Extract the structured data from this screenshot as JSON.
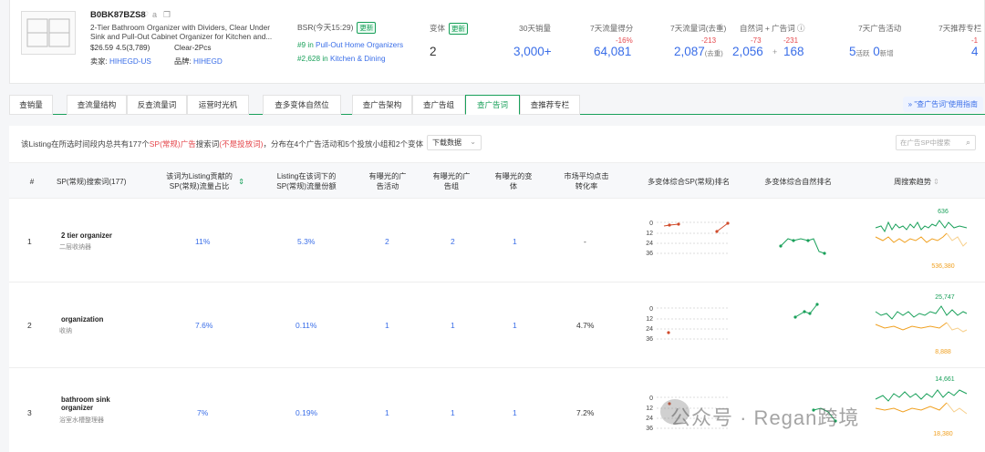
{
  "product": {
    "asin": "B0BK87BZS8",
    "title": "2-Tier Bathroom Organizer with Dividers, Clear Under Sink and Pull-Out Cabinet Organizer for Kitchen and...",
    "price": "$26.59",
    "rating": "4.5(3,789)",
    "variant": "Clear-2Pcs",
    "seller_label": "卖家:",
    "seller": "HIHEGD-US",
    "brand_label": "品牌:",
    "brand": "HIHEGD"
  },
  "bsr": {
    "label": "BSR(今天15:29)",
    "tag": "更新",
    "rank1": "#9",
    "cat1": "Pull-Out Home Organizers",
    "rank2": "#2,628",
    "cat2": "Kitchen & Dining"
  },
  "stats": {
    "variants_label": "变体",
    "variants_tag": "更新",
    "variants_value": "2",
    "sales_label": "30天销量",
    "sales_value": "3,000+",
    "flow_label": "7天流量得分",
    "flow_change": "-16%",
    "flow_value": "64,081",
    "kw_label": "7天流量词(去重)",
    "kw_change": "-213",
    "kw_value": "2,087",
    "kw_unit": "(去重)",
    "nat_label": "自然词 + 广告词 ⓘ",
    "nat_change": "-73",
    "ad_change": "-231",
    "nat_value": "2,056",
    "ad_value": "168",
    "camp_label": "7天广告活动",
    "camp_active": "5",
    "camp_active_unit": "活跃",
    "camp_new": "0",
    "camp_new_unit": "新增",
    "rec_label": "7天推荐专栏",
    "rec_change": "-1",
    "rec_value": "4"
  },
  "tabs": [
    "查销量",
    "查流量结构",
    "反查流量词",
    "运营时光机",
    "查多变体自然位",
    "查广告架构",
    "查广告组",
    "查广告词",
    "查推荐专栏"
  ],
  "guide": "\"查广告词\"使用指南",
  "info": {
    "pre": "该Listing在所选时间段内总共有177个",
    "red1": "SP(常规)广告",
    "mid": "搜索词",
    "red2": "(不是投放词)",
    "post": "，分布在4个广告活动和5个投放小组和2个变体"
  },
  "download": "下载数据",
  "search_placeholder": "在广告SP中搜索",
  "headers": [
    "#",
    "SP(常规)搜索词(177)",
    "该词为Listing贡献的SP(常规)流量占比",
    "Listing在该词下的SP(常规)流量份额",
    "有曝光的广告活动",
    "有曝光的广告组",
    "有曝光的变体",
    "市场平均点击转化率",
    "多变体综合SP(常规)排名",
    "多变体综合自然排名",
    "周搜索趋势"
  ],
  "rows": [
    {
      "num": "1",
      "kw": "2 tier organizer",
      "cn": "二层收纳器",
      "share": "11%",
      "flow": "5.3%",
      "camp": "2",
      "grp": "2",
      "var": "1",
      "cvr": "-",
      "top": "636",
      "bottom": "536,380"
    },
    {
      "num": "2",
      "kw": "organization",
      "cn": "收纳",
      "share": "7.6%",
      "flow": "0.11%",
      "camp": "1",
      "grp": "1",
      "var": "1",
      "cvr": "4.7%",
      "top": "25,747",
      "bottom": "8,888"
    },
    {
      "num": "3",
      "kw": "bathroom sink organizer",
      "cn": "浴室水槽整理器",
      "share": "7%",
      "flow": "0.19%",
      "camp": "1",
      "grp": "1",
      "var": "1",
      "cvr": "7.2%",
      "top": "14,661",
      "bottom": "18,380"
    }
  ],
  "rank_ticks": [
    "0",
    "12",
    "24",
    "36"
  ],
  "watermark": "公众号 · Regan跨境",
  "colors": {
    "accent": "#19a05a",
    "link": "#3a6ee8",
    "neg": "#e5484d",
    "trend_green": "#19a05a",
    "trend_orange": "#f0a020"
  }
}
